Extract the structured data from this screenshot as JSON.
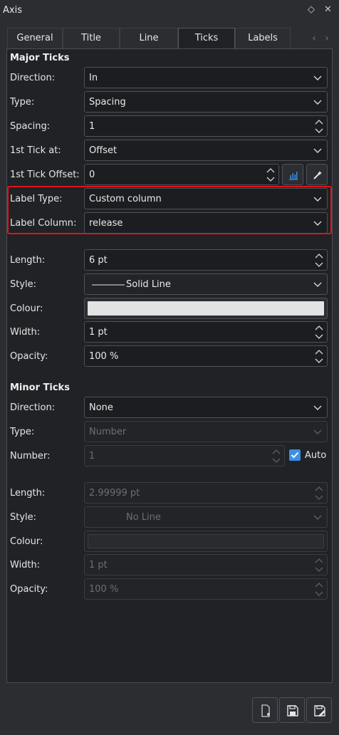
{
  "window": {
    "title": "Axis"
  },
  "tabs": [
    {
      "label": "General"
    },
    {
      "label": "Title"
    },
    {
      "label": "Line"
    },
    {
      "label": "Ticks"
    },
    {
      "label": "Labels"
    }
  ],
  "active_tab": "Ticks",
  "major": {
    "heading": "Major Ticks",
    "direction": {
      "label": "Direction:",
      "value": "In"
    },
    "type": {
      "label": "Type:",
      "value": "Spacing"
    },
    "spacing": {
      "label": "Spacing:",
      "value": "1"
    },
    "first_tick": {
      "label": "1st Tick at:",
      "value": "Offset"
    },
    "first_tick_offset": {
      "label": "1st Tick Offset:",
      "value": "0"
    },
    "label_type": {
      "label": "Label Type:",
      "value": "Custom column"
    },
    "label_column": {
      "label": "Label Column:",
      "value": "release"
    },
    "length": {
      "label": "Length:",
      "value": "6 pt"
    },
    "style": {
      "label": "Style:",
      "value": "Solid Line"
    },
    "colour": {
      "label": "Colour:",
      "value": "#e3e3e3"
    },
    "width": {
      "label": "Width:",
      "value": "1 pt"
    },
    "opacity": {
      "label": "Opacity:",
      "value": "100 %"
    }
  },
  "minor": {
    "heading": "Minor Ticks",
    "direction": {
      "label": "Direction:",
      "value": "None"
    },
    "type": {
      "label": "Type:",
      "value": "Number"
    },
    "number": {
      "label": "Number:",
      "value": "1"
    },
    "auto": {
      "label": "Auto",
      "checked": true
    },
    "length": {
      "label": "Length:",
      "value": "2.99999 pt"
    },
    "style": {
      "label": "Style:",
      "value": "No Line"
    },
    "colour": {
      "label": "Colour:",
      "value": "#2a2b2f"
    },
    "width": {
      "label": "Width:",
      "value": "1 pt"
    },
    "opacity": {
      "label": "Opacity:",
      "value": "100 %"
    }
  },
  "colors": {
    "highlight": "#e0141c",
    "accent": "#3d8ee6"
  }
}
